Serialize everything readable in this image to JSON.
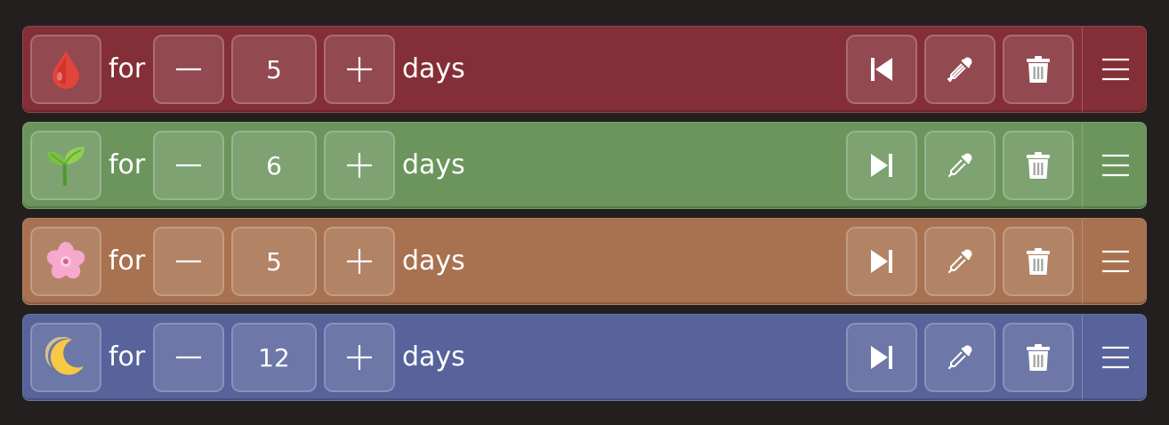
{
  "labels": {
    "for": "for",
    "days": "days"
  },
  "phases": [
    {
      "icon": "blood-drop-icon",
      "color": "#842f37",
      "days": "5",
      "skip": "skip-back-icon"
    },
    {
      "icon": "seedling-icon",
      "color": "#6b955d",
      "days": "6",
      "skip": "skip-forward-icon"
    },
    {
      "icon": "cherry-blossom-icon",
      "color": "#a87150",
      "days": "5",
      "skip": "skip-forward-icon"
    },
    {
      "icon": "crescent-moon-icon",
      "color": "#58639c",
      "days": "12",
      "skip": "skip-forward-icon"
    }
  ]
}
